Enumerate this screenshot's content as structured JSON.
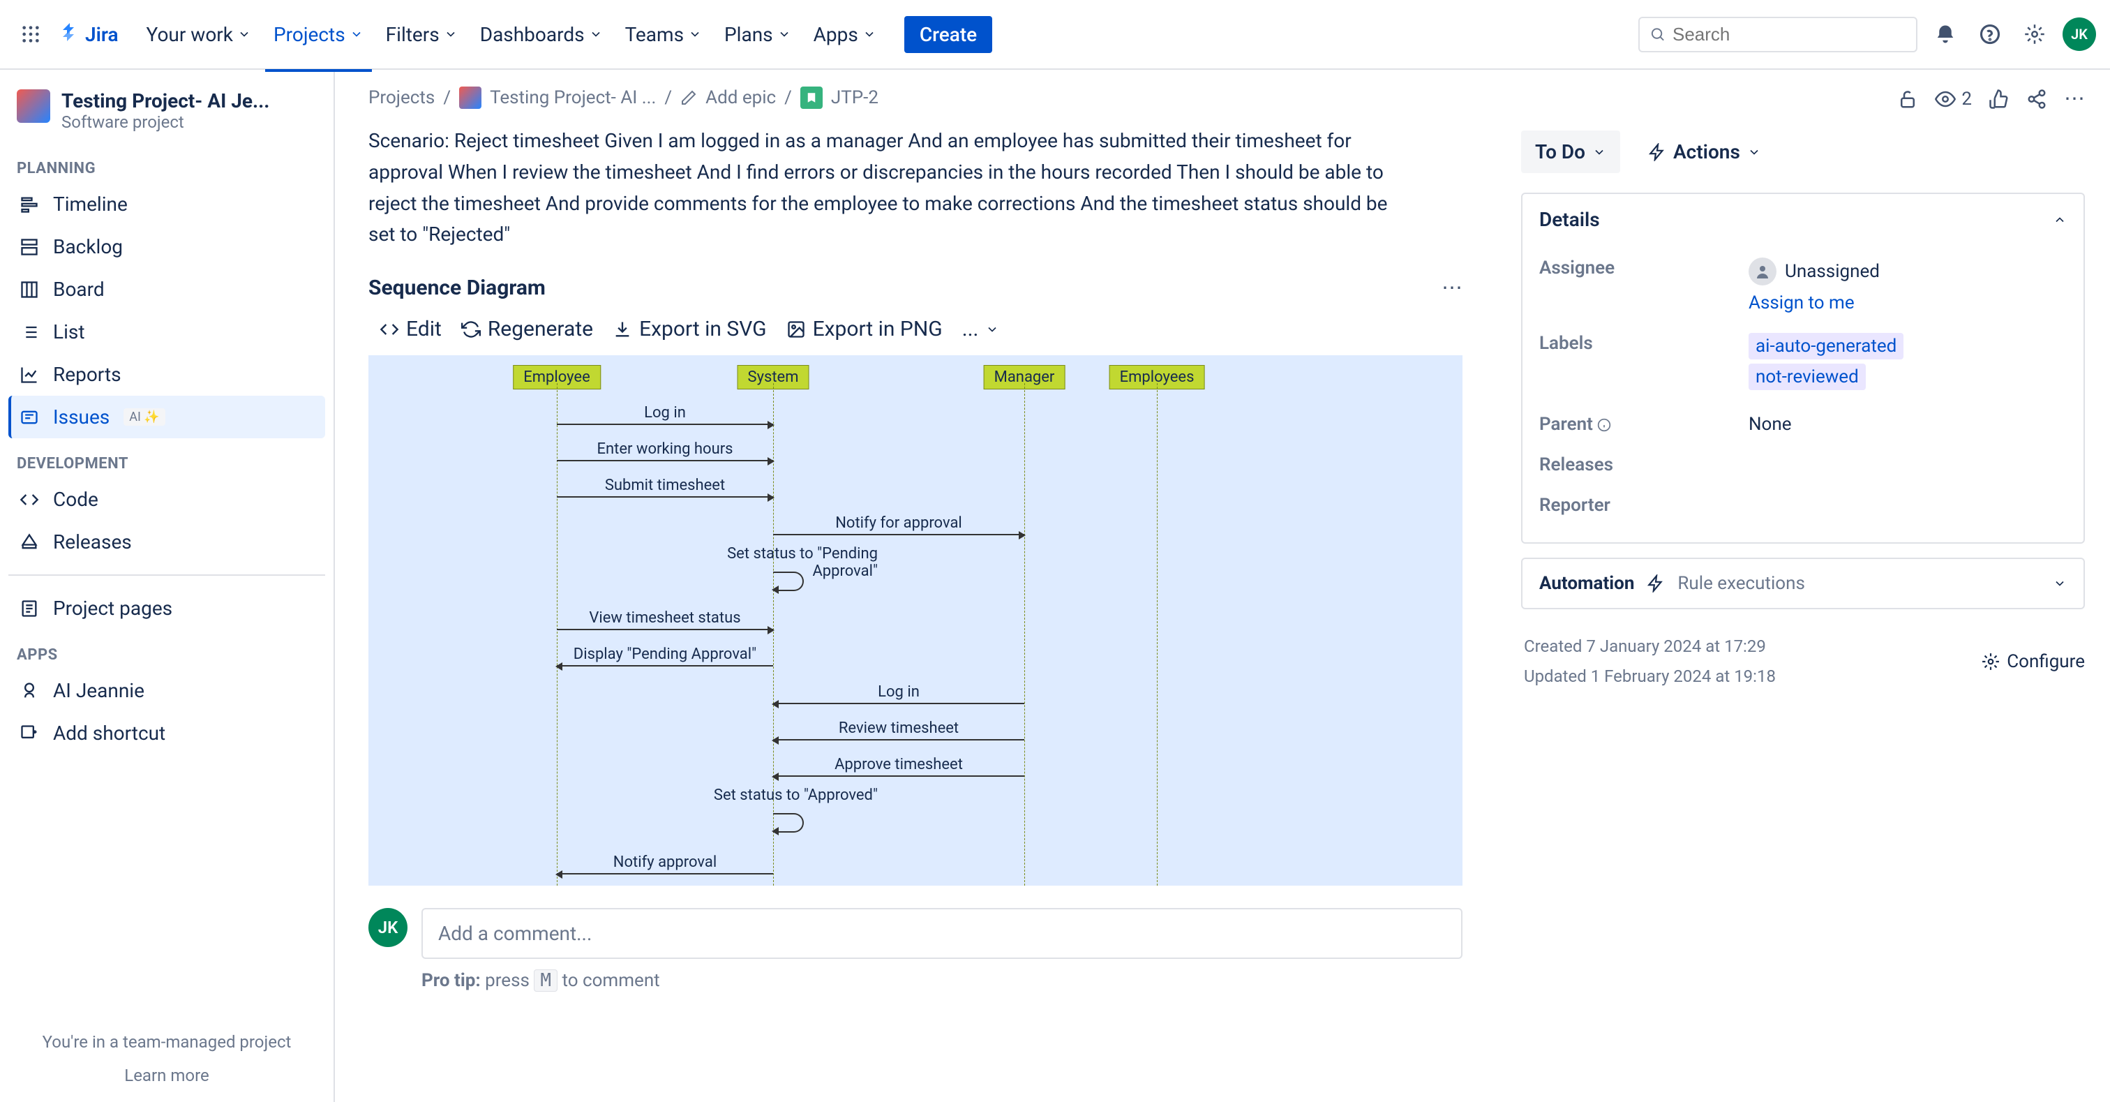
{
  "topnav": {
    "logo": "Jira",
    "items": [
      "Your work",
      "Projects",
      "Filters",
      "Dashboards",
      "Teams",
      "Plans",
      "Apps"
    ],
    "active_index": 1,
    "create": "Create",
    "search_placeholder": "Search",
    "avatar_initials": "JK"
  },
  "sidebar": {
    "project_title": "Testing Project- AI Je...",
    "project_sub": "Software project",
    "sections": {
      "planning_label": "PLANNING",
      "planning": [
        "Timeline",
        "Backlog",
        "Board",
        "List",
        "Reports",
        "Issues"
      ],
      "planning_active": 5,
      "ai_badge": "AI ✨",
      "development_label": "DEVELOPMENT",
      "development": [
        "Code",
        "Releases"
      ],
      "project_pages": "Project pages",
      "apps_label": "APPS",
      "apps": [
        "AI Jeannie"
      ],
      "add_shortcut": "Add shortcut"
    },
    "footer_text": "You're in a team-managed project",
    "footer_link": "Learn more"
  },
  "breadcrumbs": {
    "projects": "Projects",
    "project": "Testing Project- AI ...",
    "add_epic": "Add epic",
    "issue_key": "JTP-2"
  },
  "scenario": "Scenario: Reject timesheet Given I am logged in as a manager And an employee has submitted their timesheet for approval When I review the timesheet And I find errors or discrepancies in the hours recorded Then I should be able to reject the timesheet And provide comments for the employee to make corrections And the timesheet status should be set to \"Rejected\"",
  "diagram": {
    "title": "Sequence Diagram",
    "toolbar": {
      "edit": "Edit",
      "regenerate": "Regenerate",
      "export_svg": "Export in SVG",
      "export_png": "Export in PNG",
      "more": "..."
    },
    "participants": [
      "Employee",
      "System",
      "Manager",
      "Employees"
    ],
    "messages": [
      "Log in",
      "Enter working hours",
      "Submit timesheet",
      "Notify for approval",
      "Set status to \"Pending Approval\"",
      "View timesheet status",
      "Display \"Pending Approval\"",
      "Log in",
      "Review timesheet",
      "Approve timesheet",
      "Set status to \"Approved\"",
      "Notify approval"
    ]
  },
  "comment": {
    "placeholder": "Add a comment...",
    "pro_tip_prefix": "Pro tip:",
    "pro_tip_press": "press",
    "pro_tip_key": "M",
    "pro_tip_suffix": "to comment",
    "avatar": "JK"
  },
  "right": {
    "watchers": "2",
    "status": "To Do",
    "actions": "Actions",
    "details_header": "Details",
    "assignee_label": "Assignee",
    "assignee_value": "Unassigned",
    "assign_to_me": "Assign to me",
    "labels_label": "Labels",
    "labels": [
      "ai-auto-generated",
      "not-reviewed"
    ],
    "parent_label": "Parent",
    "parent_value": "None",
    "releases_label": "Releases",
    "reporter_label": "Reporter",
    "automation_header": "Automation",
    "automation_sub": "Rule executions",
    "created": "Created 7 January 2024 at 17:29",
    "updated": "Updated 1 February 2024 at 19:18",
    "configure": "Configure"
  }
}
